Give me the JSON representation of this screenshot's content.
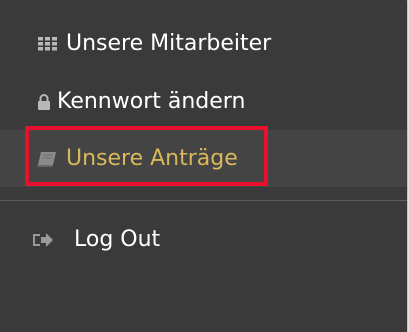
{
  "menu": {
    "items": [
      {
        "label": "Unsere Mitarbeiter",
        "icon": "grid-icon"
      },
      {
        "label": "Kennwort ändern",
        "icon": "lock-icon"
      },
      {
        "label": "Unsere Anträge",
        "icon": "book-icon",
        "active": true
      },
      {
        "label": "Log Out",
        "icon": "sign-out-icon"
      }
    ]
  },
  "colors": {
    "panel_background": "#3a3a3a",
    "active_item_background": "#444444",
    "active_text": "#d8b85a",
    "text": "#ffffff",
    "highlight_border": "#e8102a",
    "icon": "#b8b8b8"
  }
}
